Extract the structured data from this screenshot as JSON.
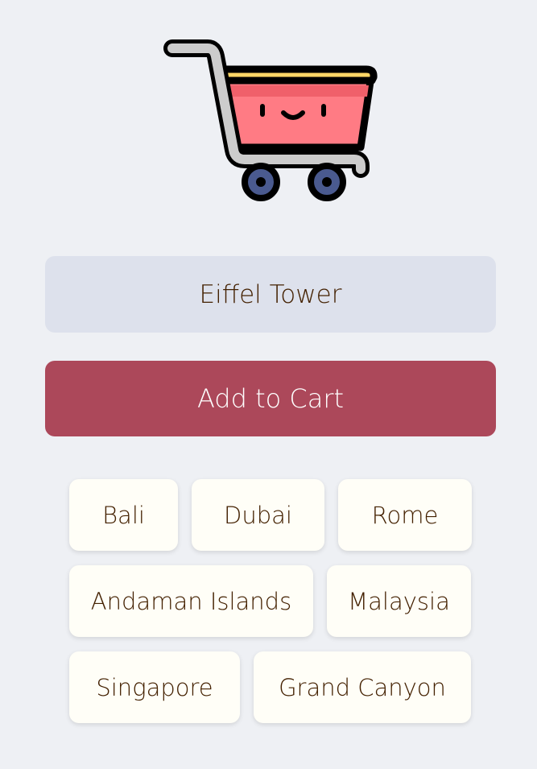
{
  "cart": {
    "icon": "shopping-cart-icon",
    "colors": {
      "basket": "#ff7b84",
      "basket_shade": "#f0606a",
      "rim": "#ffd666",
      "handle": "#cccccc",
      "wheel": "#4a5a8f",
      "outline": "#000000"
    }
  },
  "input": {
    "value": "Eiffel Tower",
    "placeholder": ""
  },
  "add_button": {
    "label": "Add to Cart"
  },
  "items": [
    [
      "Bali",
      "Dubai",
      "Rome"
    ],
    [
      "Andaman Islands",
      "Malaysia"
    ],
    [
      "Singapore",
      "Grand Canyon"
    ]
  ],
  "colors": {
    "background": "#eef0f4",
    "input_bg": "#dde1ec",
    "button_bg": "#ac485a",
    "chip_bg": "#fffef7",
    "text": "#432000"
  }
}
